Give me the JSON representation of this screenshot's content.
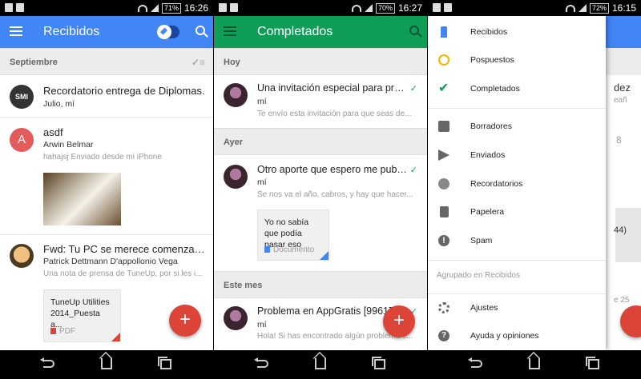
{
  "panel1": {
    "status": {
      "battery": "71%",
      "time": "16:26"
    },
    "toolbar": {
      "title": "Recibidos"
    },
    "section": "Septiembre",
    "items": [
      {
        "avatar_text": "SMI",
        "title": "Recordatorio entrega de Diplomas.",
        "sender": "Julio, mí"
      },
      {
        "avatar_text": "A",
        "title": "asdf",
        "sender": "Arwin Belmar",
        "snippet": "hahajsj Enviado desde mi iPhone"
      },
      {
        "title": "Fwd: Tu PC se merece comenzar fre...",
        "sender": "Patrick Dettmann D'appollonio Vega",
        "snippet": "Una nota de prensa de TuneUp, por si les i...",
        "attachment": {
          "title": "TuneUp Utilities 2014_Puesta a...",
          "type": "PDF"
        }
      }
    ],
    "fab": "+"
  },
  "panel2": {
    "status": {
      "battery": "70%",
      "time": "16:27"
    },
    "toolbar": {
      "title": "Completados"
    },
    "sections": [
      "Hoy",
      "Ayer",
      "Este mes"
    ],
    "items": [
      {
        "title": "Una invitación especial para probar...",
        "sender": "mí",
        "snippet": "Te envío esta invitación para que seas de..."
      },
      {
        "title": "Otro aporte que espero me publiquen...",
        "sender": "mí",
        "snippet": "Se nos va el año, cabros, y hay que hacer...",
        "attachment": {
          "title": "Yo no sabía que podía pasar eso",
          "type": "Documento"
        }
      },
      {
        "title": "Problema en AppGratis [996176]",
        "sender": "mí",
        "snippet": "Hola! Si has encontrado algún problema c..."
      }
    ],
    "fab": "+"
  },
  "panel3": {
    "status": {
      "battery": "72%",
      "time": "16:15"
    },
    "behind": {
      "t1": "dez",
      "t2": "eañ",
      "t3": "8",
      "t4": "44)",
      "t5": "e 25"
    },
    "drawer": {
      "primary": [
        "Recibidos",
        "Pospuestos",
        "Completados"
      ],
      "secondary": [
        "Borradores",
        "Enviados",
        "Recordatorios",
        "Papelera",
        "Spam"
      ],
      "group_label": "Agrupado en Recibidos",
      "footer": [
        "Ajustes",
        "Ayuda y opiniones"
      ]
    }
  },
  "colors": {
    "inbox_blue": "#4285f4",
    "done_green": "#0f9d58",
    "fab_red": "#db4437",
    "snooze_yellow": "#f4b400"
  }
}
